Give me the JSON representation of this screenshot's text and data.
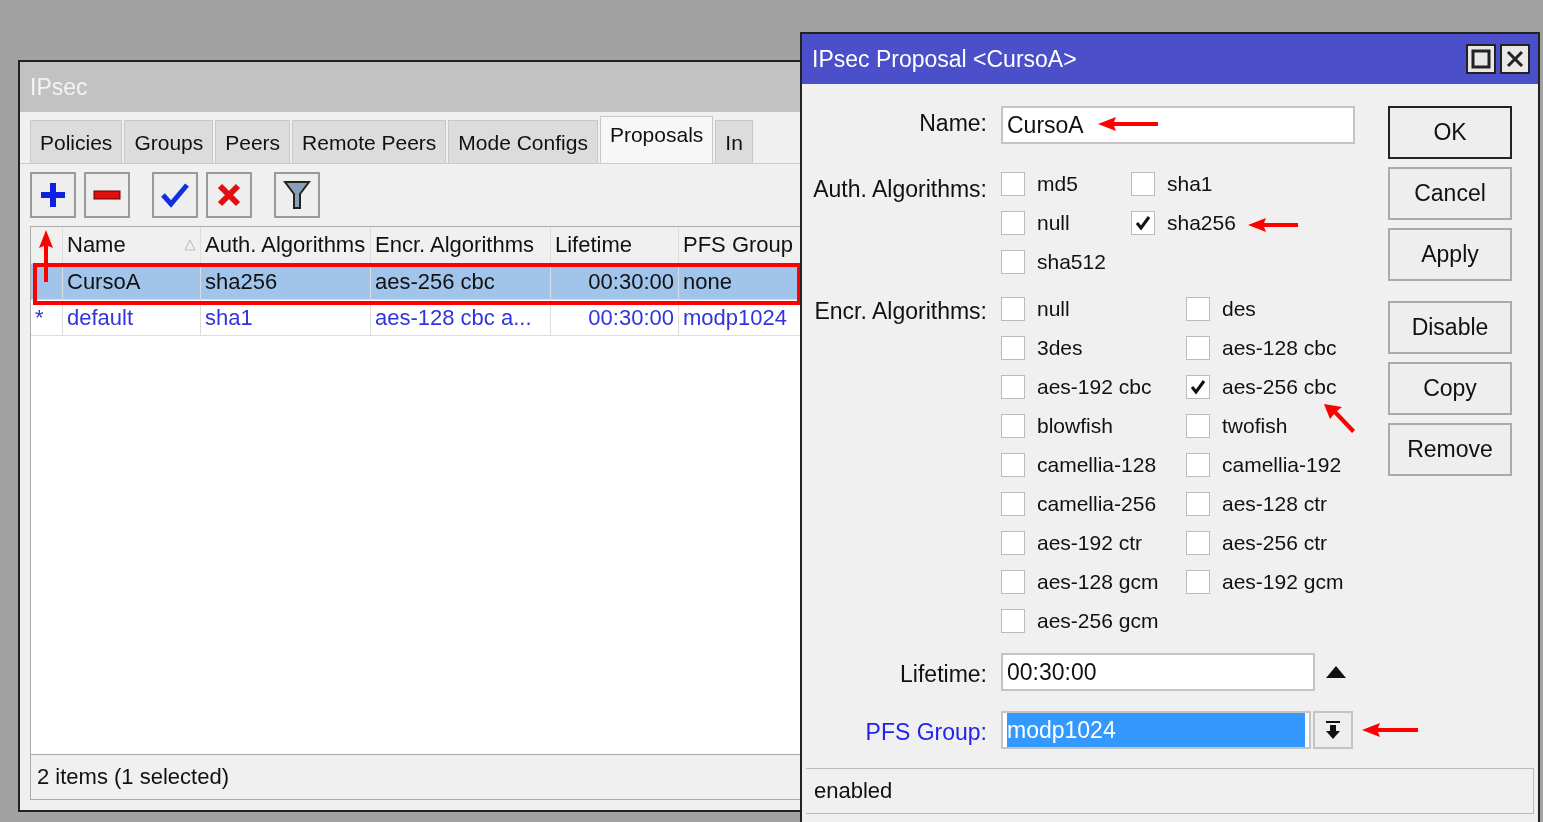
{
  "main_window": {
    "title": "IPsec",
    "tabs": [
      {
        "label": "Policies",
        "selected": false
      },
      {
        "label": "Groups",
        "selected": false
      },
      {
        "label": "Peers",
        "selected": false
      },
      {
        "label": "Remote Peers",
        "selected": false
      },
      {
        "label": "Mode Configs",
        "selected": false
      },
      {
        "label": "Proposals",
        "selected": true
      },
      {
        "label": "In",
        "selected": false
      }
    ],
    "table": {
      "columns": [
        "Name",
        "Auth. Algorithms",
        "Encr. Algorithms",
        "Lifetime",
        "PFS Group"
      ],
      "rows": [
        {
          "selected": true,
          "default": false,
          "cells": [
            "CursoA",
            "sha256",
            "aes-256 cbc",
            "00:30:00",
            "none"
          ]
        },
        {
          "selected": false,
          "default": true,
          "marker": "*",
          "cells": [
            "default",
            "sha1",
            "aes-128 cbc a...",
            "00:30:00",
            "modp1024"
          ]
        }
      ]
    },
    "status_bar": "2 items (1 selected)"
  },
  "dialog": {
    "title": "IPsec Proposal <CursoA>",
    "name": {
      "label": "Name:",
      "value": "CursoA"
    },
    "auth_algorithms": {
      "label": "Auth. Algorithms:",
      "options": [
        {
          "label": "md5",
          "checked": false
        },
        {
          "label": "sha1",
          "checked": false
        },
        {
          "label": "null",
          "checked": false
        },
        {
          "label": "sha256",
          "checked": true
        },
        {
          "label": "sha512",
          "checked": false
        }
      ]
    },
    "encr_algorithms": {
      "label": "Encr. Algorithms:",
      "options": [
        {
          "label": "null",
          "checked": false
        },
        {
          "label": "des",
          "checked": false
        },
        {
          "label": "3des",
          "checked": false
        },
        {
          "label": "aes-128 cbc",
          "checked": false
        },
        {
          "label": "aes-192 cbc",
          "checked": false
        },
        {
          "label": "aes-256 cbc",
          "checked": true
        },
        {
          "label": "blowfish",
          "checked": false
        },
        {
          "label": "twofish",
          "checked": false
        },
        {
          "label": "camellia-128",
          "checked": false
        },
        {
          "label": "camellia-192",
          "checked": false
        },
        {
          "label": "camellia-256",
          "checked": false
        },
        {
          "label": "aes-128 ctr",
          "checked": false
        },
        {
          "label": "aes-192 ctr",
          "checked": false
        },
        {
          "label": "aes-256 ctr",
          "checked": false
        },
        {
          "label": "aes-128 gcm",
          "checked": false
        },
        {
          "label": "aes-192 gcm",
          "checked": false
        },
        {
          "label": "aes-256 gcm",
          "checked": false
        }
      ]
    },
    "lifetime": {
      "label": "Lifetime:",
      "value": "00:30:00"
    },
    "pfs_group": {
      "label": "PFS Group:",
      "label_active": true,
      "value": "modp1024",
      "value_selected": true
    },
    "buttons": [
      {
        "label": "OK",
        "default": true
      },
      {
        "label": "Cancel",
        "default": false
      },
      {
        "label": "Apply",
        "default": false
      },
      {
        "label": "Disable",
        "default": false
      },
      {
        "label": "Copy",
        "default": false
      },
      {
        "label": "Remove",
        "default": false
      }
    ],
    "status_bar": "enabled"
  }
}
